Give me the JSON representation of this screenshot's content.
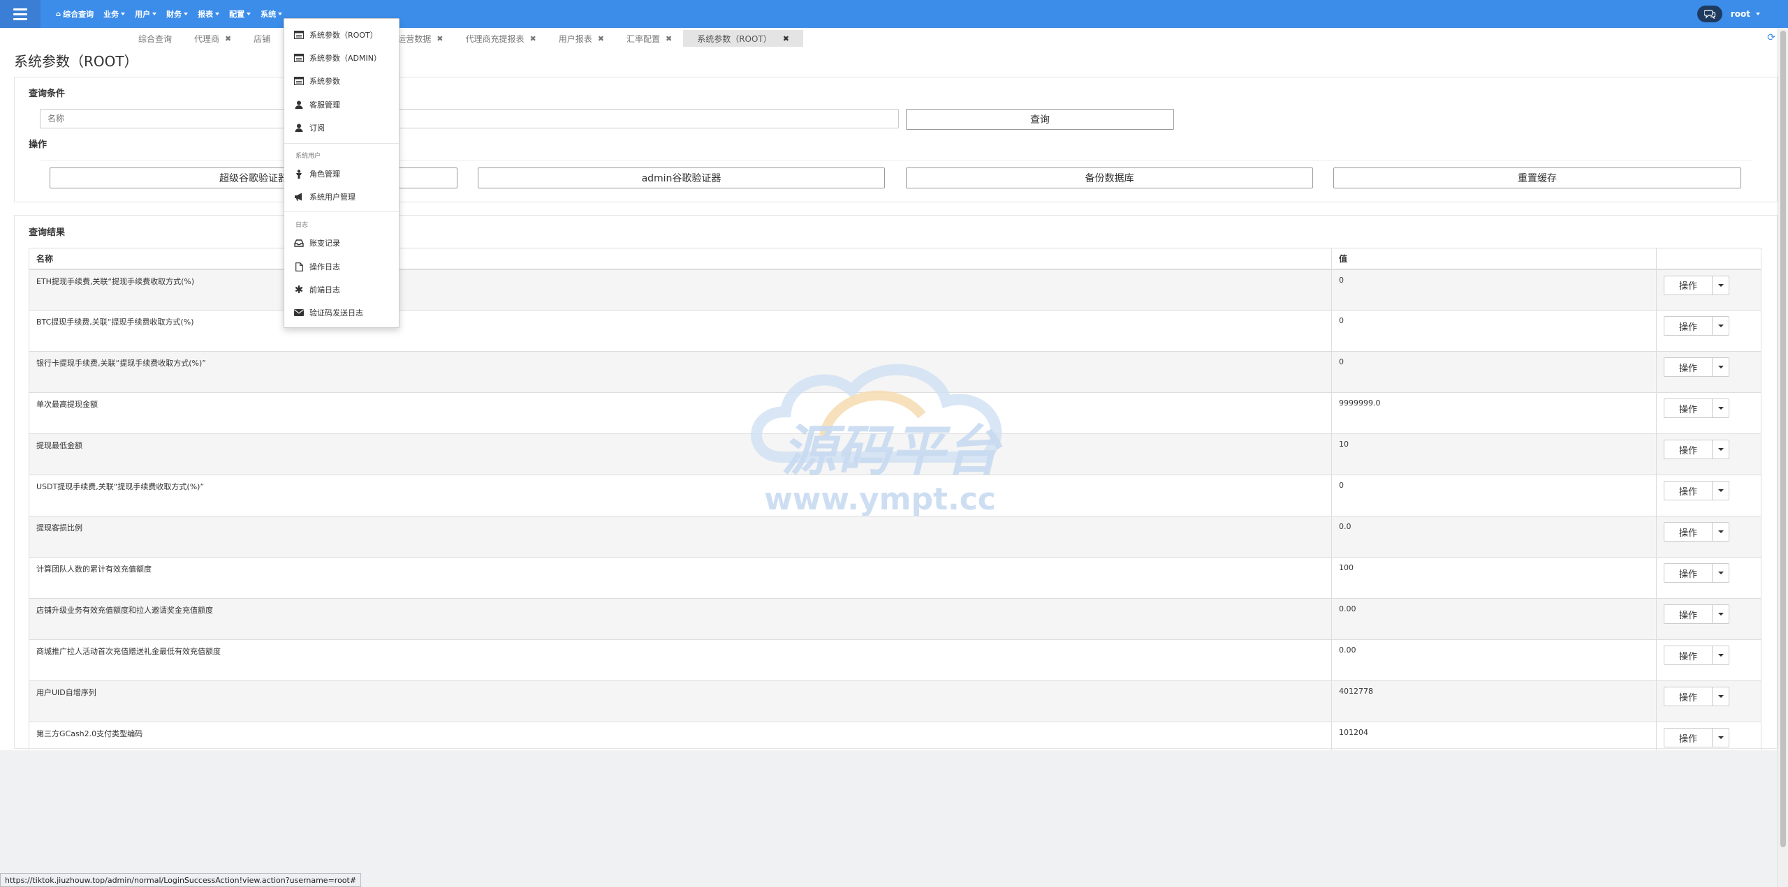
{
  "navbar": {
    "items": [
      {
        "label": "综合查询",
        "icon": "home-icon",
        "caret": false
      },
      {
        "label": "业务",
        "caret": true
      },
      {
        "label": "用户",
        "caret": true
      },
      {
        "label": "财务",
        "caret": true
      },
      {
        "label": "报表",
        "caret": true
      },
      {
        "label": "配置",
        "caret": true
      },
      {
        "label": "系统",
        "caret": true
      }
    ],
    "user": "root"
  },
  "tabs": [
    {
      "label": "综合查询",
      "closable": false
    },
    {
      "label": "代理商",
      "closable": true
    },
    {
      "label": "店铺",
      "closable": true
    },
    {
      "label": "运营数据",
      "closable": true
    },
    {
      "label": "代理商充提报表",
      "closable": true
    },
    {
      "label": "用户报表",
      "closable": true
    },
    {
      "label": "汇率配置",
      "closable": true
    },
    {
      "label": "系统参数（ROOT）",
      "closable": true,
      "active": true
    }
  ],
  "page_title": "系统参数（ROOT）",
  "query": {
    "title": "查询条件",
    "name_placeholder": "名称",
    "search_label": "查询",
    "ops_title": "操作",
    "buttons": [
      "超级谷歌验证器",
      "admin谷歌验证器",
      "备份数据库",
      "重置缓存"
    ]
  },
  "results": {
    "title": "查询结果",
    "columns": [
      "名称",
      "值",
      ""
    ],
    "op_label": "操作",
    "rows": [
      {
        "name": "ETH提现手续费,关联“提现手续费收取方式(%)",
        "value": "0"
      },
      {
        "name": "BTC提现手续费,关联“提现手续费收取方式(%)",
        "value": "0"
      },
      {
        "name": "银行卡提现手续费,关联“提现手续费收取方式(%)”",
        "value": "0"
      },
      {
        "name": "单次最高提现金额",
        "value": "9999999.0"
      },
      {
        "name": "提现最低金额",
        "value": "10"
      },
      {
        "name": "USDT提现手续费,关联“提现手续费收取方式(%)”",
        "value": "0"
      },
      {
        "name": "提现客损比例",
        "value": "0.0"
      },
      {
        "name": "计算团队人数的累计有效充值额度",
        "value": "100"
      },
      {
        "name": "店铺升级业务有效充值额度和拉人邀请奖金充值额度",
        "value": "0.00"
      },
      {
        "name": "商城推广拉人活动首次充值赠送礼金最低有效充值额度",
        "value": "0.00"
      },
      {
        "name": "用户UID自增序列",
        "value": "4012778"
      },
      {
        "name": "第三方GCash2.0支付类型编码",
        "value": "101204"
      }
    ]
  },
  "dropdown": {
    "items_top": [
      {
        "label": "系统参数（ROOT）",
        "icon": "list-icon"
      },
      {
        "label": "系统参数（ADMIN）",
        "icon": "list-icon"
      },
      {
        "label": "系统参数",
        "icon": "list-icon"
      },
      {
        "label": "客服管理",
        "icon": "user-icon"
      },
      {
        "label": "订阅",
        "icon": "user-icon"
      }
    ],
    "header_system_users": "系统用户",
    "items_users": [
      {
        "label": "角色管理",
        "icon": "role-icon"
      },
      {
        "label": "系统用户管理",
        "icon": "megaphone-icon"
      }
    ],
    "header_logs": "日志",
    "items_logs": [
      {
        "label": "账变记录",
        "icon": "inbox-icon"
      },
      {
        "label": "操作日志",
        "icon": "file-icon"
      },
      {
        "label": "前端日志",
        "icon": "asterisk-icon"
      },
      {
        "label": "验证码发送日志",
        "icon": "envelope-icon"
      }
    ]
  },
  "watermark": {
    "line1": "源码平台",
    "line2": "www.ympt.cc"
  },
  "status_url": "https://tiktok.jiuzhouw.top/admin/normal/LoginSuccessAction!view.action?username=root#",
  "colors": {
    "navbar": "#3c8dea",
    "accent": "#3c8dea"
  }
}
